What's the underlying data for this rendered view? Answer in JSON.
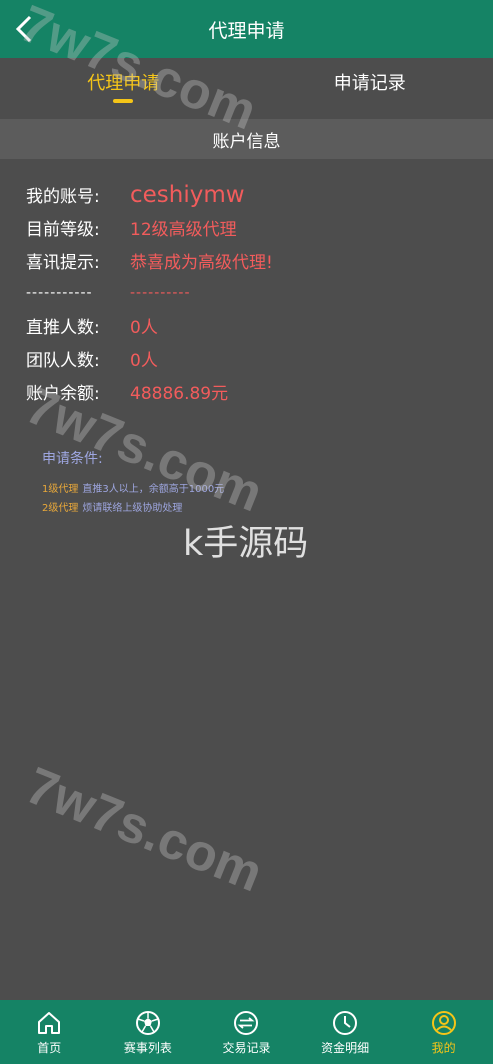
{
  "header": {
    "title": "代理申请"
  },
  "tabs": [
    {
      "label": "代理申请",
      "active": true
    },
    {
      "label": "申请记录",
      "active": false
    }
  ],
  "section": {
    "title": "账户信息"
  },
  "account": {
    "rows_top": [
      {
        "label": "我的账号:",
        "value": "ceshiymw"
      },
      {
        "label": "目前等级:",
        "value": "12级高级代理"
      },
      {
        "label": "喜讯提示:",
        "value": "恭喜成为高级代理!"
      }
    ],
    "divider_left": "-----------",
    "divider_right": "----------",
    "rows_bottom": [
      {
        "label": "直推人数:",
        "value": "0人"
      },
      {
        "label": "团队人数:",
        "value": "0人"
      },
      {
        "label": "账户余额:",
        "value": "48886.89元"
      }
    ]
  },
  "conditions": {
    "title": "申请条件:",
    "lines": [
      {
        "level": "1级代理",
        "desc": "直推3人以上，余额高于1000元"
      },
      {
        "level": "2级代理",
        "desc": "烦请联络上级协助处理"
      }
    ]
  },
  "watermarks": {
    "site": "7w7s.com",
    "center": "k手源码"
  },
  "footer": {
    "items": [
      {
        "label": "首页",
        "icon": "home-icon",
        "active": false
      },
      {
        "label": "赛事列表",
        "icon": "soccer-ball-icon",
        "active": false
      },
      {
        "label": "交易记录",
        "icon": "exchange-icon",
        "active": false
      },
      {
        "label": "资金明细",
        "icon": "clock-icon",
        "active": false
      },
      {
        "label": "我的",
        "icon": "user-icon",
        "active": true
      }
    ]
  },
  "colors": {
    "primary": "#158365",
    "accent": "#f5c518",
    "value": "#f25c5c",
    "background": "#4d4d4d"
  }
}
